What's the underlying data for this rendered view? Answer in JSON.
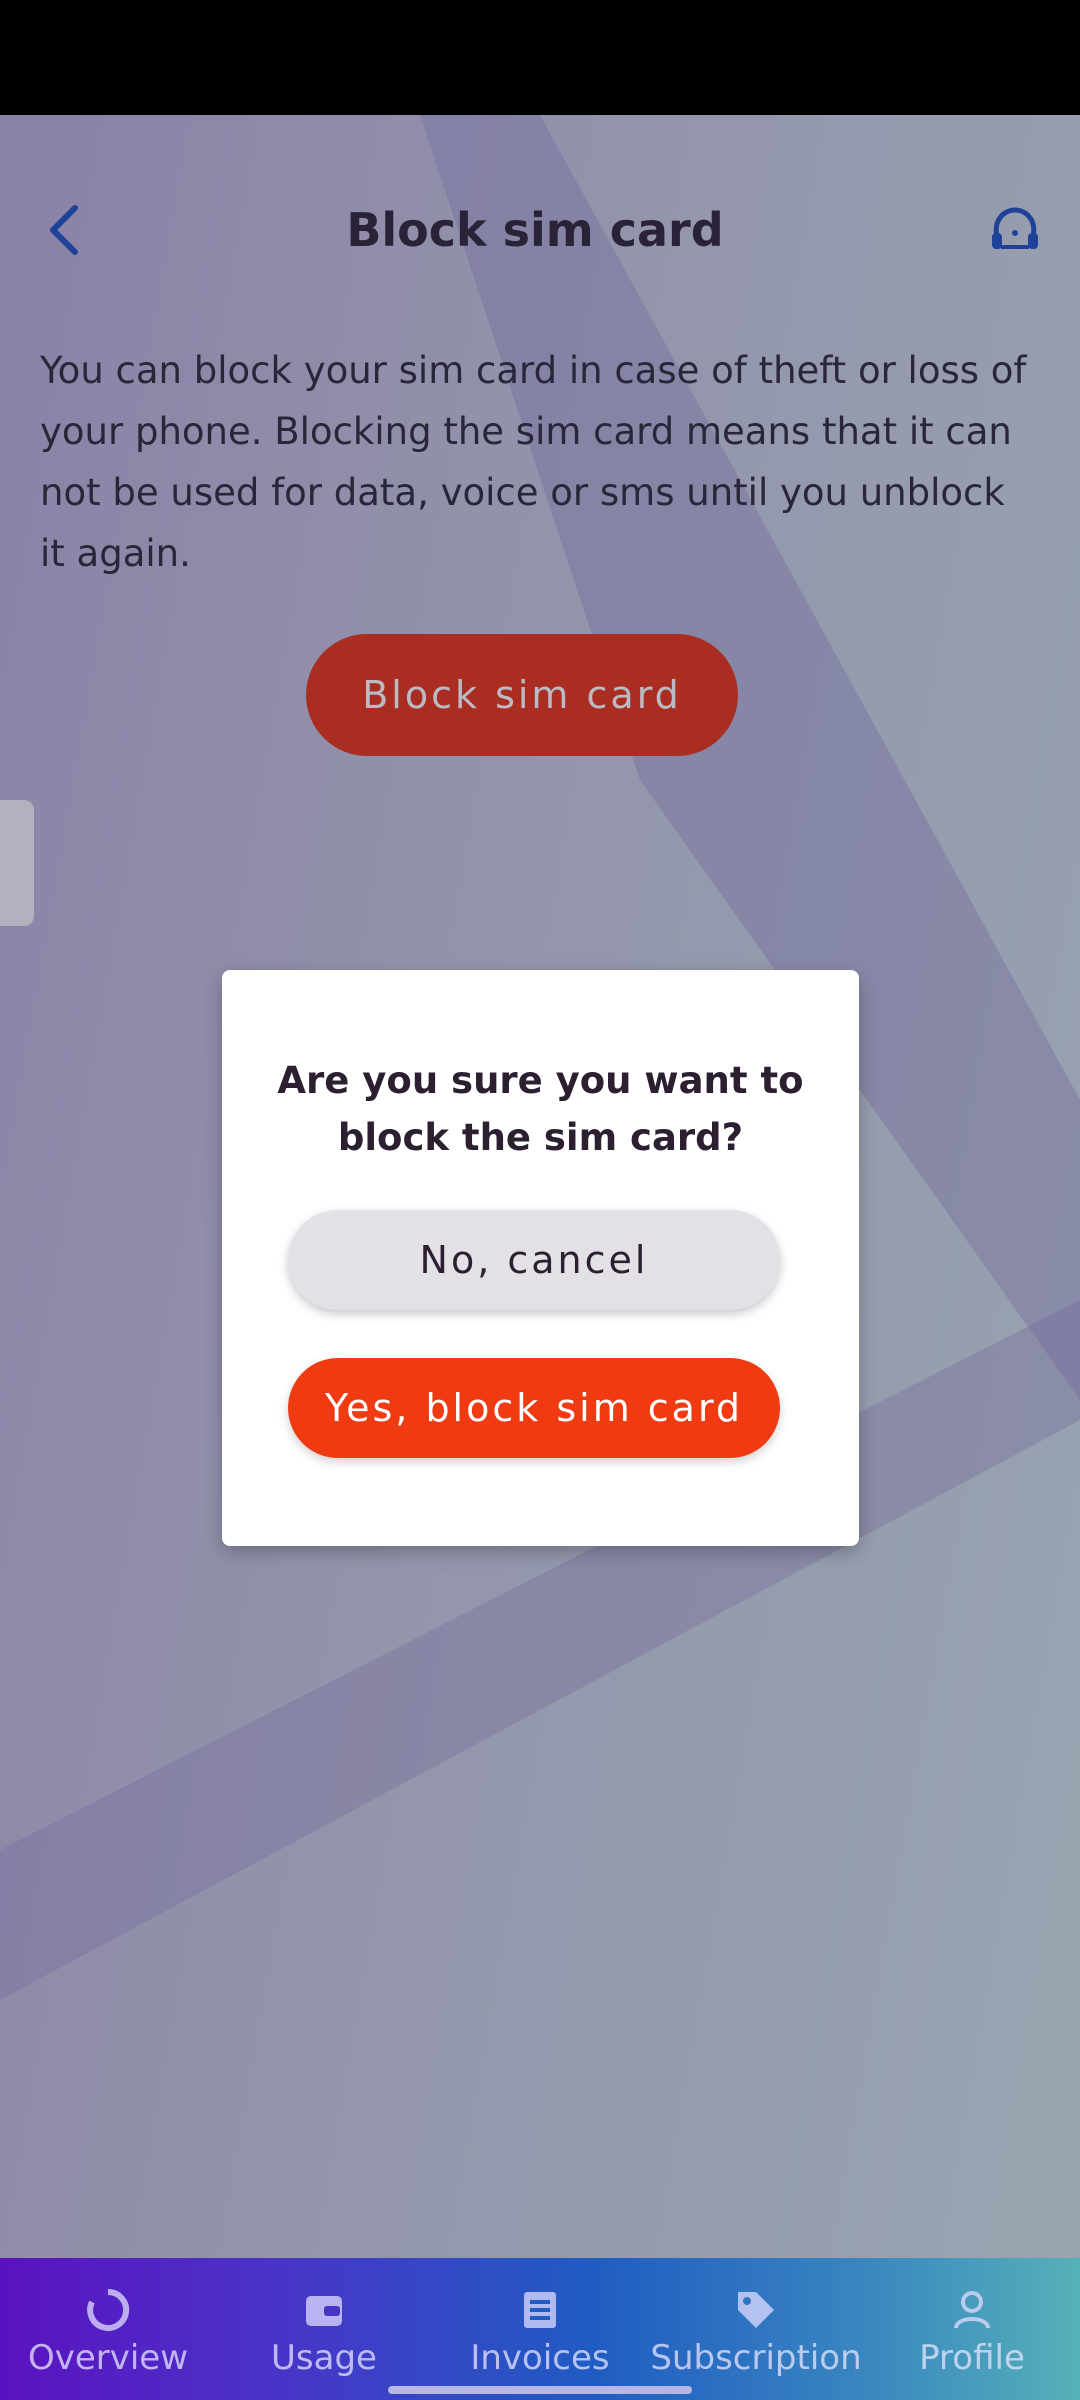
{
  "header": {
    "title": "Block sim card"
  },
  "content": {
    "description": "You can block your sim card in case of theft or loss of your phone. Blocking the sim card means that it can not be used for data, voice or sms until you unblock it again.",
    "block_button_label": "Block sim card"
  },
  "dialog": {
    "title": "Are you sure you want to block the sim card?",
    "cancel_label": "No, cancel",
    "confirm_label": "Yes, block sim card"
  },
  "bottom_nav": {
    "items": [
      {
        "label": "Overview",
        "icon": "overview-icon"
      },
      {
        "label": "Usage",
        "icon": "wallet-icon"
      },
      {
        "label": "Invoices",
        "icon": "invoice-icon"
      },
      {
        "label": "Subscription",
        "icon": "tag-icon"
      },
      {
        "label": "Profile",
        "icon": "person-icon"
      }
    ]
  },
  "colors": {
    "accent": "#e8300f",
    "icon_blue": "#1b4fc0",
    "title": "#2b1f30"
  }
}
